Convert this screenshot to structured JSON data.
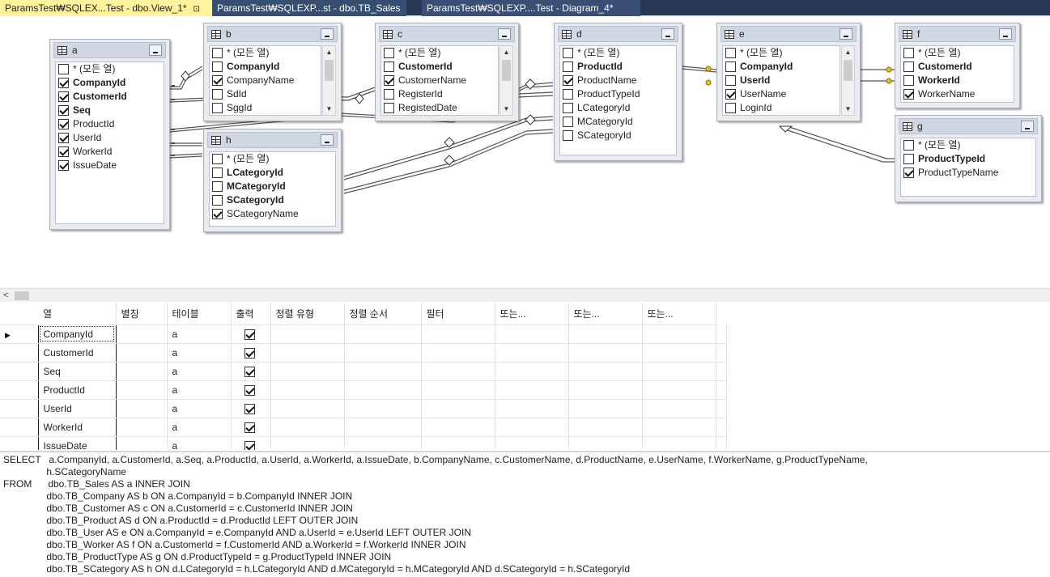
{
  "tabs": [
    {
      "label": "ParamsTest₩SQLEX...Test - dbo.View_1*",
      "state": "active",
      "pin": "⊡"
    },
    {
      "label": "ParamsTest₩SQLEXP...st - dbo.TB_Sales",
      "state": "inactive",
      "close": "×"
    },
    {
      "label": "ParamsTest₩SQLEXP....Test - Diagram_4*",
      "state": "preview"
    }
  ],
  "diagram": {
    "tables": [
      {
        "name": "a",
        "scroll": false,
        "columns": [
          {
            "label": "* (모든 열)",
            "checked": false,
            "key": false
          },
          {
            "label": "CompanyId",
            "checked": true,
            "key": true
          },
          {
            "label": "CustomerId",
            "checked": true,
            "key": true
          },
          {
            "label": "Seq",
            "checked": true,
            "key": true
          },
          {
            "label": "ProductId",
            "checked": true,
            "key": false
          },
          {
            "label": "UserId",
            "checked": true,
            "key": false
          },
          {
            "label": "WorkerId",
            "checked": true,
            "key": false
          },
          {
            "label": "IssueDate",
            "checked": true,
            "key": false
          }
        ]
      },
      {
        "name": "b",
        "scroll": true,
        "columns": [
          {
            "label": "* (모든 열)",
            "checked": false,
            "key": false
          },
          {
            "label": "CompanyId",
            "checked": false,
            "key": true
          },
          {
            "label": "CompanyName",
            "checked": true,
            "key": false
          },
          {
            "label": "SdId",
            "checked": false,
            "key": false
          },
          {
            "label": "SggId",
            "checked": false,
            "key": false
          }
        ]
      },
      {
        "name": "c",
        "scroll": true,
        "columns": [
          {
            "label": "* (모든 열)",
            "checked": false,
            "key": false
          },
          {
            "label": "CustomerId",
            "checked": false,
            "key": true
          },
          {
            "label": "CustomerName",
            "checked": true,
            "key": false
          },
          {
            "label": "RegisterId",
            "checked": false,
            "key": false
          },
          {
            "label": "RegistedDate",
            "checked": false,
            "key": false
          }
        ]
      },
      {
        "name": "d",
        "scroll": false,
        "columns": [
          {
            "label": "* (모든 열)",
            "checked": false,
            "key": false
          },
          {
            "label": "ProductId",
            "checked": false,
            "key": true
          },
          {
            "label": "ProductName",
            "checked": true,
            "key": false
          },
          {
            "label": "ProductTypeId",
            "checked": false,
            "key": false
          },
          {
            "label": "LCategoryId",
            "checked": false,
            "key": false
          },
          {
            "label": "MCategoryId",
            "checked": false,
            "key": false
          },
          {
            "label": "SCategoryId",
            "checked": false,
            "key": false
          }
        ]
      },
      {
        "name": "e",
        "scroll": true,
        "columns": [
          {
            "label": "* (모든 열)",
            "checked": false,
            "key": false
          },
          {
            "label": "CompanyId",
            "checked": false,
            "key": true
          },
          {
            "label": "UserId",
            "checked": false,
            "key": true
          },
          {
            "label": "UserName",
            "checked": true,
            "key": false
          },
          {
            "label": "LoginId",
            "checked": false,
            "key": false
          }
        ]
      },
      {
        "name": "f",
        "scroll": false,
        "columns": [
          {
            "label": "* (모든 열)",
            "checked": false,
            "key": false
          },
          {
            "label": "CustomerId",
            "checked": false,
            "key": true
          },
          {
            "label": "WorkerId",
            "checked": false,
            "key": true
          },
          {
            "label": "WorkerName",
            "checked": true,
            "key": false
          }
        ]
      },
      {
        "name": "g",
        "scroll": false,
        "columns": [
          {
            "label": "* (모든 열)",
            "checked": false,
            "key": false
          },
          {
            "label": "ProductTypeId",
            "checked": false,
            "key": true
          },
          {
            "label": "ProductTypeName",
            "checked": true,
            "key": false
          }
        ]
      },
      {
        "name": "h",
        "scroll": false,
        "columns": [
          {
            "label": "* (모든 열)",
            "checked": false,
            "key": false
          },
          {
            "label": "LCategoryId",
            "checked": false,
            "key": true
          },
          {
            "label": "MCategoryId",
            "checked": false,
            "key": true
          },
          {
            "label": "SCategoryId",
            "checked": false,
            "key": true
          },
          {
            "label": "SCategoryName",
            "checked": true,
            "key": false
          }
        ]
      }
    ]
  },
  "scrollbar": {
    "left_arrow": "<"
  },
  "grid": {
    "row_marker": "▶",
    "headers": [
      "열",
      "별칭",
      "테이블",
      "출력",
      "정렬 유형",
      "정렬 순서",
      "필터",
      "또는...",
      "또는...",
      "또는..."
    ],
    "rows": [
      {
        "column": "CompanyId",
        "alias": "",
        "table": "a",
        "output": true
      },
      {
        "column": "CustomerId",
        "alias": "",
        "table": "a",
        "output": true
      },
      {
        "column": "Seq",
        "alias": "",
        "table": "a",
        "output": true
      },
      {
        "column": "ProductId",
        "alias": "",
        "table": "a",
        "output": true
      },
      {
        "column": "UserId",
        "alias": "",
        "table": "a",
        "output": true
      },
      {
        "column": "WorkerId",
        "alias": "",
        "table": "a",
        "output": true
      },
      {
        "column": "IssueDate",
        "alias": "",
        "table": "a",
        "output": true
      }
    ]
  },
  "sql": {
    "lines": [
      "SELECT   a.CompanyId, a.CustomerId, a.Seq, a.ProductId, a.UserId, a.WorkerId, a.IssueDate, b.CompanyName, c.CustomerName, d.ProductName, e.UserName, f.WorkerName, g.ProductTypeName,",
      "                h.SCategoryName",
      "FROM      dbo.TB_Sales AS a INNER JOIN",
      "                dbo.TB_Company AS b ON a.CompanyId = b.CompanyId INNER JOIN",
      "                dbo.TB_Customer AS c ON a.CustomerId = c.CustomerId INNER JOIN",
      "                dbo.TB_Product AS d ON a.ProductId = d.ProductId LEFT OUTER JOIN",
      "                dbo.TB_User AS e ON a.CompanyId = e.CompanyId AND a.UserId = e.UserId LEFT OUTER JOIN",
      "                dbo.TB_Worker AS f ON a.CustomerId = f.CustomerId AND a.WorkerId = f.WorkerId INNER JOIN",
      "                dbo.TB_ProductType AS g ON d.ProductTypeId = g.ProductTypeId INNER JOIN",
      "                dbo.TB_SCategory AS h ON d.LCategoryId = h.LCategoryId AND d.MCategoryId = h.MCategoryId AND d.SCategoryId = h.SCategoryId"
    ]
  },
  "colors": {
    "tabstrip": "#293955",
    "active_tab": "#fff29d",
    "table_header": "#cfd7e2",
    "key_icon": "#e8c21a"
  }
}
